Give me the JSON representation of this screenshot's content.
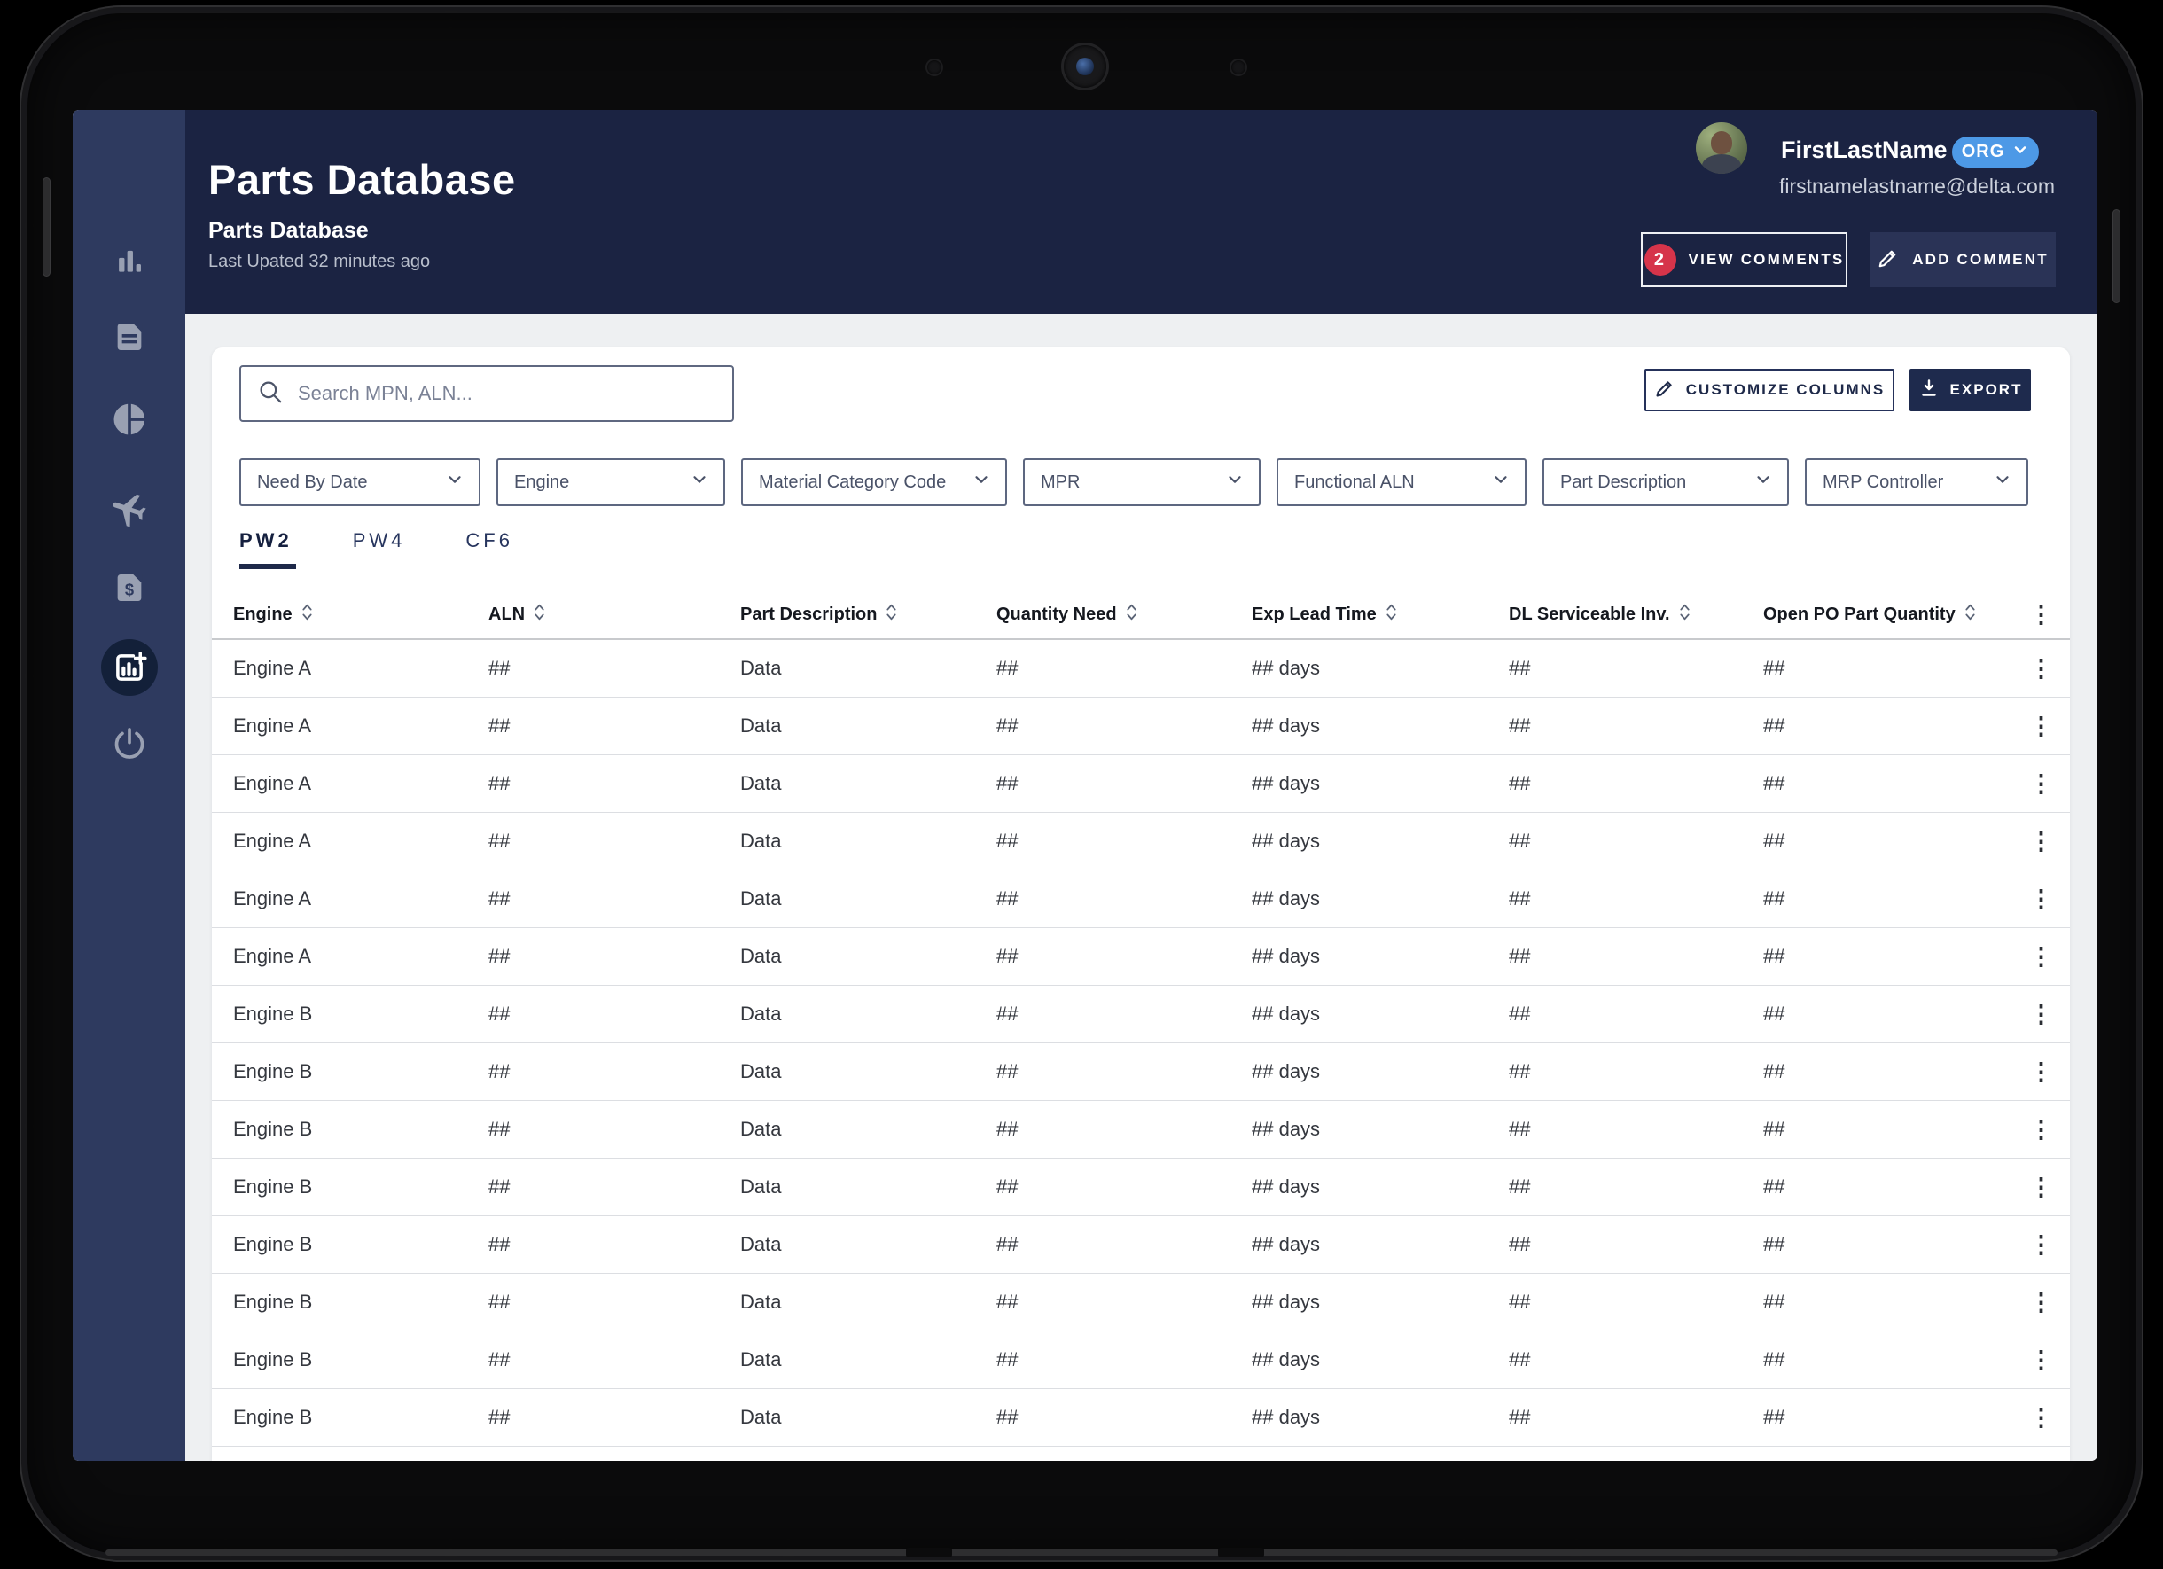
{
  "colors": {
    "header_navy": "#1b2342",
    "sidebar_navy": "#2e3a5f",
    "accent_blue": "#4d99e6",
    "badge_red": "#d6344a",
    "button_navy": "#1e2a4d",
    "text_navy": "#1e2949"
  },
  "app": {
    "sidebar": {
      "items": [
        {
          "id": "analytics",
          "icon": "bar-chart-icon",
          "active": false
        },
        {
          "id": "documents",
          "icon": "document-icon",
          "active": false
        },
        {
          "id": "reports",
          "icon": "pie-chart-icon",
          "active": false
        },
        {
          "id": "flights",
          "icon": "airplane-icon",
          "active": false
        },
        {
          "id": "invoices",
          "icon": "document-dollar-icon",
          "active": false
        },
        {
          "id": "parts-database",
          "icon": "chart-add-icon",
          "active": true
        },
        {
          "id": "logout",
          "icon": "power-icon",
          "active": false
        }
      ]
    },
    "header": {
      "title": "Parts Database",
      "subtitle": "Parts Database",
      "last_updated": "Last Upated 32 minutes ago",
      "user": {
        "name": "FirstLastName",
        "email": "firstnamelastname@delta.com",
        "org_label": "ORG"
      },
      "view_comments": {
        "count": "2",
        "label": "VIEW COMMENTS"
      },
      "add_comment": {
        "label": "ADD COMMENT"
      }
    },
    "toolbar": {
      "search_placeholder": "Search MPN, ALN...",
      "customize_label": "CUSTOMIZE COLUMNS",
      "export_label": "EXPORT"
    },
    "filters": [
      "Need By Date",
      "Engine",
      "Material Category Code",
      "MPR",
      "Functional ALN",
      "Part Description",
      "MRP Controller"
    ],
    "tabs": [
      {
        "label": "PW2",
        "active": true
      },
      {
        "label": "PW4",
        "active": false
      },
      {
        "label": "CF6",
        "active": false
      }
    ],
    "table": {
      "columns": [
        "Engine",
        "ALN",
        "Part Description",
        "Quantity Need",
        "Exp Lead Time",
        "DL Serviceable Inv.",
        "Open PO Part Quantity"
      ],
      "rows": [
        {
          "engine": "Engine A",
          "aln": "##",
          "part_description": "Data",
          "quantity_need": "##",
          "exp_lead_time": "## days",
          "dl_serviceable_inv": "##",
          "open_po_part_quantity": "##"
        },
        {
          "engine": "Engine A",
          "aln": "##",
          "part_description": "Data",
          "quantity_need": "##",
          "exp_lead_time": "## days",
          "dl_serviceable_inv": "##",
          "open_po_part_quantity": "##"
        },
        {
          "engine": "Engine A",
          "aln": "##",
          "part_description": "Data",
          "quantity_need": "##",
          "exp_lead_time": "## days",
          "dl_serviceable_inv": "##",
          "open_po_part_quantity": "##"
        },
        {
          "engine": "Engine A",
          "aln": "##",
          "part_description": "Data",
          "quantity_need": "##",
          "exp_lead_time": "## days",
          "dl_serviceable_inv": "##",
          "open_po_part_quantity": "##"
        },
        {
          "engine": "Engine A",
          "aln": "##",
          "part_description": "Data",
          "quantity_need": "##",
          "exp_lead_time": "## days",
          "dl_serviceable_inv": "##",
          "open_po_part_quantity": "##"
        },
        {
          "engine": "Engine A",
          "aln": "##",
          "part_description": "Data",
          "quantity_need": "##",
          "exp_lead_time": "## days",
          "dl_serviceable_inv": "##",
          "open_po_part_quantity": "##"
        },
        {
          "engine": "Engine B",
          "aln": "##",
          "part_description": "Data",
          "quantity_need": "##",
          "exp_lead_time": "## days",
          "dl_serviceable_inv": "##",
          "open_po_part_quantity": "##"
        },
        {
          "engine": "Engine B",
          "aln": "##",
          "part_description": "Data",
          "quantity_need": "##",
          "exp_lead_time": "## days",
          "dl_serviceable_inv": "##",
          "open_po_part_quantity": "##"
        },
        {
          "engine": "Engine B",
          "aln": "##",
          "part_description": "Data",
          "quantity_need": "##",
          "exp_lead_time": "## days",
          "dl_serviceable_inv": "##",
          "open_po_part_quantity": "##"
        },
        {
          "engine": "Engine B",
          "aln": "##",
          "part_description": "Data",
          "quantity_need": "##",
          "exp_lead_time": "## days",
          "dl_serviceable_inv": "##",
          "open_po_part_quantity": "##"
        },
        {
          "engine": "Engine B",
          "aln": "##",
          "part_description": "Data",
          "quantity_need": "##",
          "exp_lead_time": "## days",
          "dl_serviceable_inv": "##",
          "open_po_part_quantity": "##"
        },
        {
          "engine": "Engine B",
          "aln": "##",
          "part_description": "Data",
          "quantity_need": "##",
          "exp_lead_time": "## days",
          "dl_serviceable_inv": "##",
          "open_po_part_quantity": "##"
        },
        {
          "engine": "Engine B",
          "aln": "##",
          "part_description": "Data",
          "quantity_need": "##",
          "exp_lead_time": "## days",
          "dl_serviceable_inv": "##",
          "open_po_part_quantity": "##"
        },
        {
          "engine": "Engine B",
          "aln": "##",
          "part_description": "Data",
          "quantity_need": "##",
          "exp_lead_time": "## days",
          "dl_serviceable_inv": "##",
          "open_po_part_quantity": "##"
        }
      ]
    }
  }
}
